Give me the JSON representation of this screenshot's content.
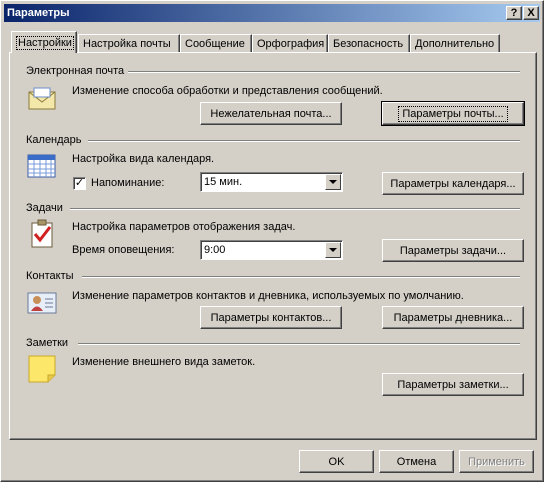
{
  "window": {
    "title": "Параметры",
    "help_btn": "?",
    "close_btn": "X"
  },
  "tabs": [
    "Настройки",
    "Настройка почты",
    "Сообщение",
    "Орфография",
    "Безопасность",
    "Дополнительно"
  ],
  "sections": {
    "email": {
      "heading": "Электронная почта",
      "desc": "Изменение способа обработки и представления сообщений.",
      "btn_junk": "Нежелательная почта...",
      "btn_mail": "Параметры почты..."
    },
    "calendar": {
      "heading": "Календарь",
      "desc": "Настройка вида календаря.",
      "reminder_label": "Напоминание:",
      "reminder_checked": true,
      "reminder_value": "15 мин.",
      "btn": "Параметры календаря..."
    },
    "tasks": {
      "heading": "Задачи",
      "desc": "Настройка параметров отображения задач.",
      "time_label": "Время оповещения:",
      "time_value": "9:00",
      "btn": "Параметры задачи..."
    },
    "contacts": {
      "heading": "Контакты",
      "desc": "Изменение параметров контактов и дневника, используемых  по умолчанию.",
      "btn_contacts": "Параметры контактов...",
      "btn_journal": "Параметры дневника..."
    },
    "notes": {
      "heading": "Заметки",
      "desc": "Изменение внешнего вида заметок.",
      "btn": "Параметры заметки..."
    }
  },
  "footer": {
    "ok": "OK",
    "cancel": "Отмена",
    "apply": "Применить"
  },
  "colors": {
    "title_start": "#0a246a",
    "title_end": "#a6caf0",
    "face": "#d4d0c8"
  }
}
